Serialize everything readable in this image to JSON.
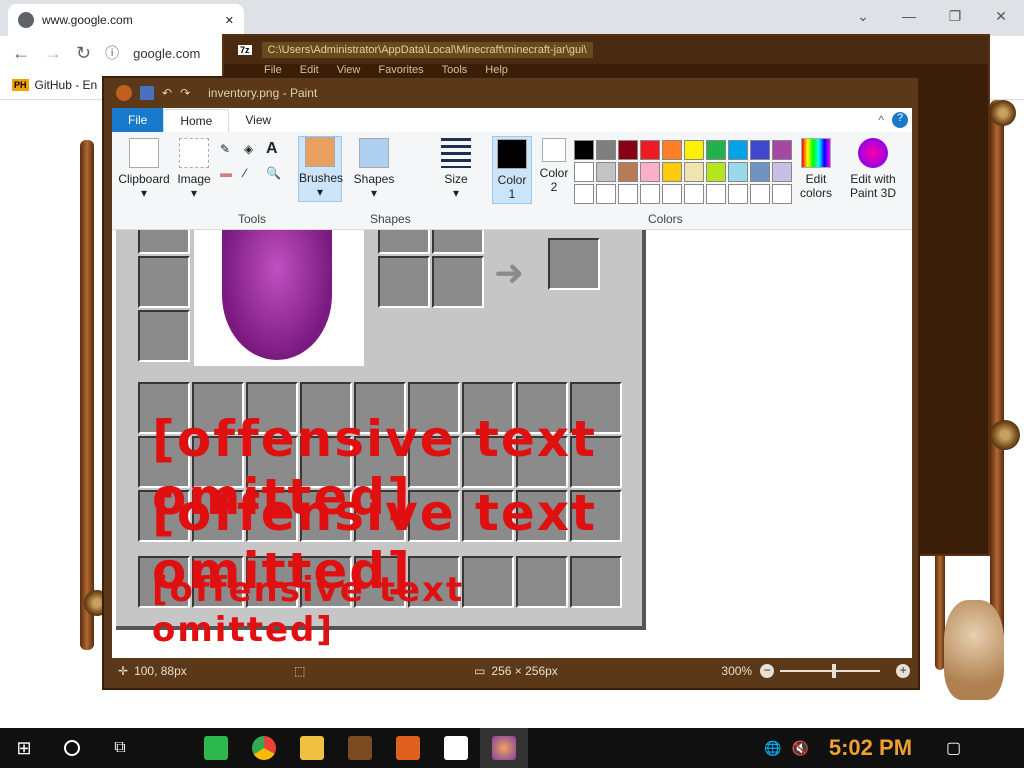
{
  "chrome": {
    "tab_title": "www.google.com",
    "tab_close": "✕",
    "address_fragment": "google.com",
    "bookmark_label": "GitHub - En",
    "bookmark_badge": "PH",
    "controls": {
      "dropdown": "⌄",
      "minimize": "—",
      "maximize": "❐",
      "close": "✕"
    },
    "nav": {
      "back": "←",
      "forward": "→",
      "reload": "↻",
      "info": "ⓘ"
    }
  },
  "sevenzip": {
    "app_icon": "7z",
    "path": "C:\\Users\\Administrator\\AppData\\Local\\Minecraft\\minecraft-jar\\gui\\",
    "menu": [
      "File",
      "Edit",
      "View",
      "Favorites",
      "Tools",
      "Help"
    ]
  },
  "paint": {
    "title": "inventory.png - Paint",
    "tabs": {
      "file": "File",
      "home": "Home",
      "view": "View"
    },
    "ribbon": {
      "clipboard": "Clipboard",
      "image": "Image",
      "tools_group": "Tools",
      "brushes": "Brushes",
      "shapes": "Shapes",
      "shapes_group": "Shapes",
      "size": "Size",
      "color1": "Color 1",
      "color2": "Color 2",
      "colors_group": "Colors",
      "edit_colors": "Edit colors",
      "edit_paint3d": "Edit with Paint 3D",
      "dropdown_arrow": "▾",
      "collapse": "^",
      "help": "?"
    },
    "palette_row1": [
      "#000000",
      "#7f7f7f",
      "#880015",
      "#ed1c24",
      "#ff7f27",
      "#fff200",
      "#22b14c",
      "#00a2e8",
      "#3f48cc",
      "#a349a4"
    ],
    "palette_row2": [
      "#ffffff",
      "#c3c3c3",
      "#b97a57",
      "#ffaec9",
      "#ffc90e",
      "#efe4b0",
      "#b5e61d",
      "#99d9ea",
      "#7092be",
      "#c8bfe7"
    ],
    "palette_row3": [
      "#ffffff",
      "#ffffff",
      "#ffffff",
      "#ffffff",
      "#ffffff",
      "#ffffff",
      "#ffffff",
      "#ffffff",
      "#ffffff",
      "#ffffff"
    ],
    "canvas_text": {
      "line1": "[offensive text omitted]",
      "line2": "[offensive text omitted]",
      "line3": "[offensive text omitted]"
    },
    "status": {
      "cursor_pos": "100, 88px",
      "image_size": "256 × 256px",
      "zoom": "300%",
      "zoom_out": "−",
      "zoom_in": "+"
    }
  },
  "taskbar": {
    "clock": "5:02 PM",
    "start_icon": "windows-icon",
    "search_icon": "cortana-icon"
  }
}
